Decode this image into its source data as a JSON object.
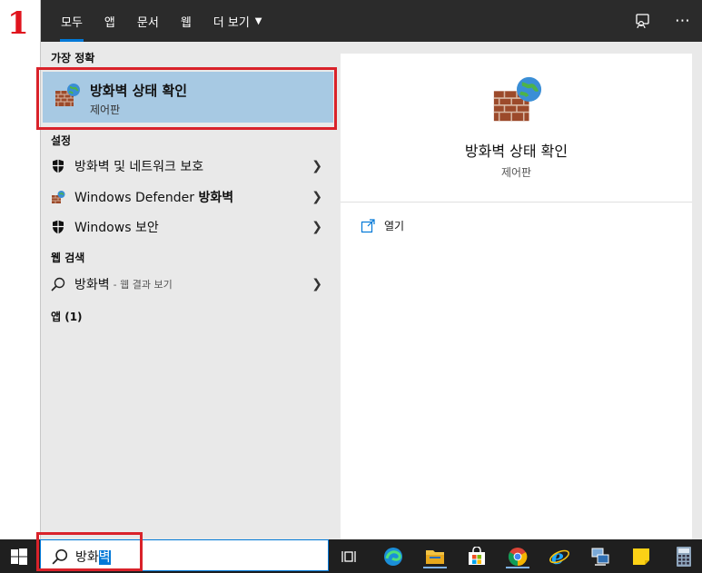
{
  "step_number": "1",
  "tabs": [
    "모두",
    "앱",
    "문서",
    "웹",
    "더 보기"
  ],
  "left": {
    "best_match_heading": "가장 정확",
    "best_match": {
      "title": "방화벽 상태 확인",
      "subtitle": "제어판"
    },
    "settings_heading": "설정",
    "settings_items": [
      {
        "label": "방화벽 및 네트워크 보호",
        "icon": "shield-icon"
      },
      {
        "label_prefix": "Windows Defender ",
        "label_bold": "방화벽",
        "icon": "firewall-icon"
      },
      {
        "label": "Windows 보안",
        "icon": "shield-icon"
      }
    ],
    "web_heading": "웹 검색",
    "web_item": {
      "label": "방화벽",
      "suffix": "- 웹 결과 보기"
    },
    "apps_heading": "앱 (1)"
  },
  "detail": {
    "title": "방화벽 상태 확인",
    "subtitle": "제어판",
    "open_label": "열기"
  },
  "search": {
    "text_plain": "방화",
    "text_selected": "벽"
  },
  "colors": {
    "accent": "#0078d7",
    "highlight": "#d9222a",
    "best_match_bg": "#a7c9e3",
    "tab_bar_bg": "#2b2b2b"
  },
  "taskbar_icons": [
    "task-view-icon",
    "edge-icon",
    "file-explorer-icon",
    "store-icon",
    "chrome-icon",
    "internet-explorer-icon",
    "network-icon",
    "sticky-notes-icon",
    "calculator-icon"
  ]
}
